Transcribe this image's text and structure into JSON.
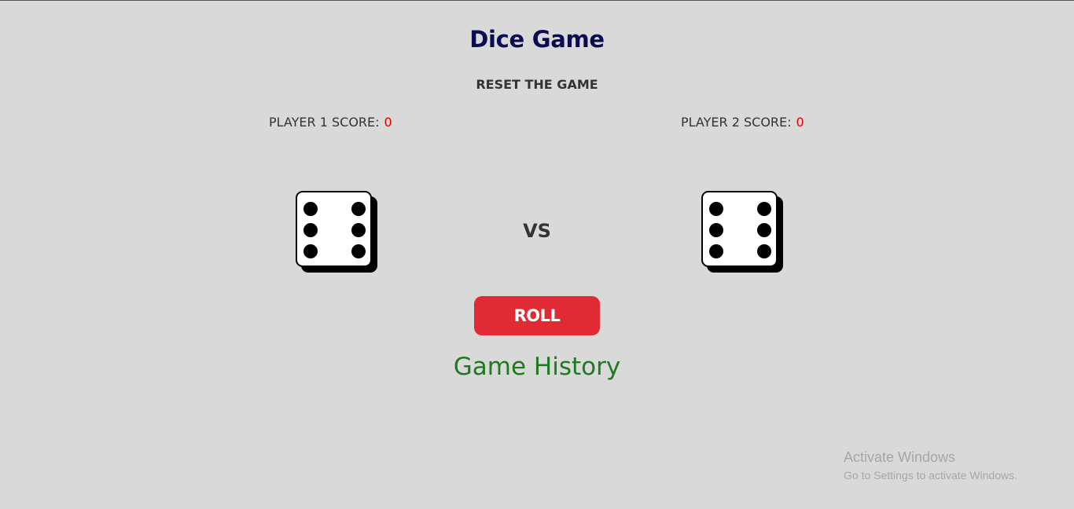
{
  "header": {
    "title": "Dice Game",
    "reset_label": "RESET THE GAME"
  },
  "players": [
    {
      "score_label": "PLAYER 1 SCORE:",
      "score": "0",
      "die_face": 6
    },
    {
      "score_label": "PLAYER 2 SCORE:",
      "score": "0",
      "die_face": 6
    }
  ],
  "vs_label": "VS",
  "roll_label": "ROLL",
  "history_title": "Game History",
  "watermark": {
    "line1": "Activate Windows",
    "line2": "Go to Settings to activate Windows."
  },
  "colors": {
    "background": "#d9d9d9",
    "title": "#0b0b4f",
    "score_value": "#e00000",
    "roll_button": "#e02b35",
    "history_title": "#1e7a1e"
  }
}
